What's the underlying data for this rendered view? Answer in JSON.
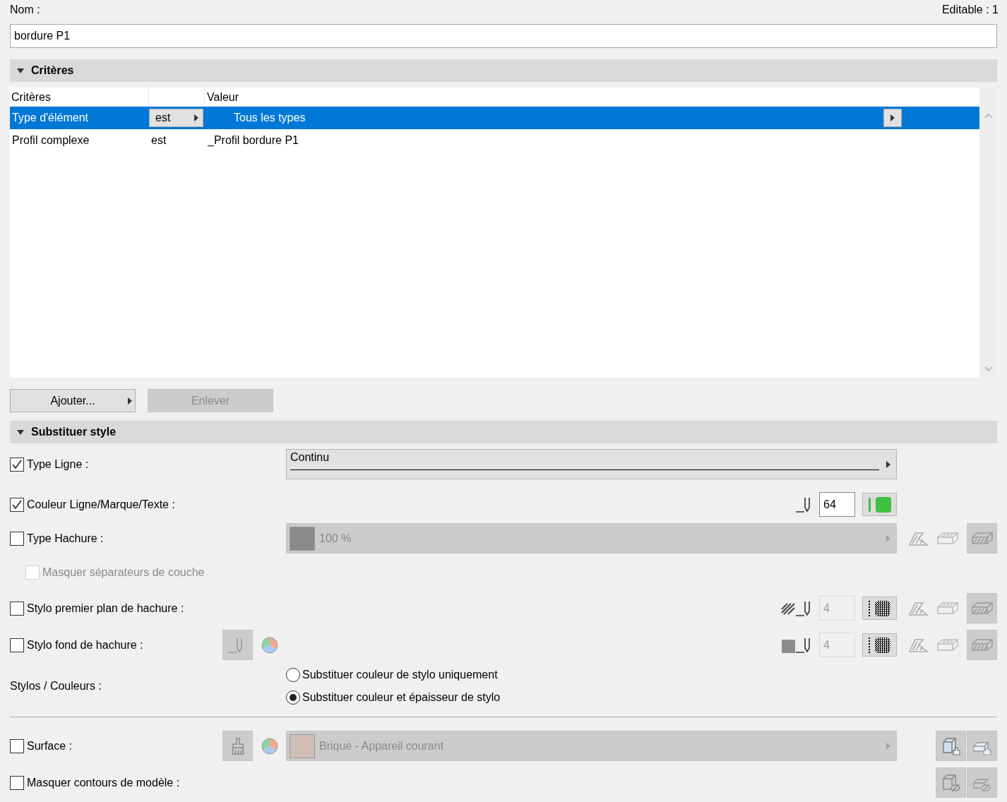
{
  "name_field": {
    "label": "Nom :",
    "value": "bordure P1"
  },
  "editable": "Editable : 1",
  "criteria": {
    "title": "Critères",
    "expanded": true,
    "column_1": "Critères",
    "column_3": "Valeur",
    "rows": [
      {
        "criterion": "Type d'élément",
        "operator": "est",
        "value": "Tous les types",
        "selected": true
      },
      {
        "criterion": "Profil complexe",
        "operator": "est",
        "value": "_Profil bordure P1",
        "selected": false
      }
    ],
    "buttons": [
      {
        "label": "Ajouter...",
        "disabled": false
      },
      {
        "label": "Enlever",
        "disabled": true
      }
    ]
  },
  "style": {
    "title": "Substituer style",
    "expanded": true,
    "rows": [
      {
        "kind": "line_type",
        "label": "Type Ligne :",
        "checked": true,
        "value": "Continu"
      },
      {
        "kind": "pen_color",
        "label": "Couleur Ligne/Marque/Texte :",
        "checked": true,
        "pen": "64",
        "color": "#40c040"
      },
      {
        "kind": "fill_type",
        "label": "Type Hachure :",
        "checked": false,
        "value": "100 %"
      },
      {
        "kind": "sub_option",
        "label": "Masquer séparateurs de couche",
        "checked": false,
        "disabled": true
      },
      {
        "kind": "fill_pen",
        "label": "Stylo premier plan de hachure :",
        "checked": false,
        "pen": "4"
      },
      {
        "kind": "fill_bg_pen",
        "label": "Stylo fond de hachure :",
        "checked": false,
        "pen": "4"
      },
      {
        "kind": "radio_group",
        "label": "Stylos / Couleurs :",
        "options": [
          {
            "label": "Substituer couleur de stylo uniquement",
            "selected": false
          },
          {
            "label": "Substituer couleur et épaisseur de stylo",
            "selected": true
          }
        ]
      },
      {
        "kind": "surface",
        "label": "Surface :",
        "checked": false,
        "value": "Brique - Appareil courant"
      },
      {
        "kind": "model_contours",
        "label": "Masquer contours de modèle :",
        "checked": false
      }
    ]
  }
}
